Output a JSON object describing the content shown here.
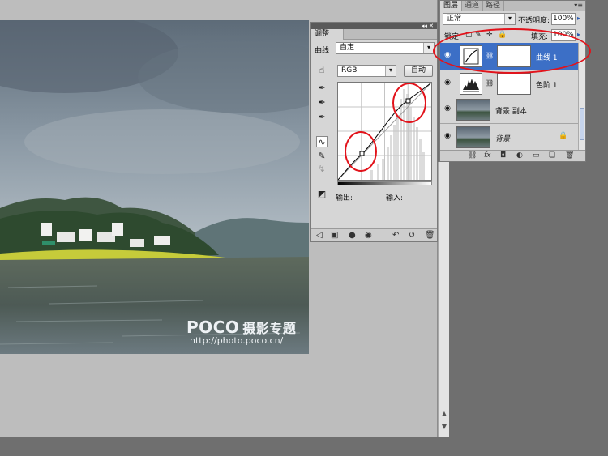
{
  "watermark": {
    "brand": "POCO",
    "brand_cn": "摄影专题",
    "url": "http://photo.poco.cn/"
  },
  "adjustments_panel": {
    "collapse_glyph": "◂◂",
    "close_glyph": "✕",
    "tab_label": "调整",
    "preset_label": "曲线",
    "preset_value": "自定",
    "channel_value": "RGB",
    "auto_button": "自动",
    "output_label": "输出:",
    "input_label": "输入:"
  },
  "layers_panel": {
    "tabs": [
      "图层",
      "通道",
      "路径"
    ],
    "menu_glyph": "▾≡",
    "blend_mode": "正常",
    "opacity_label": "不透明度:",
    "opacity_value": "100%",
    "lock_label": "锁定:",
    "fill_label": "填充:",
    "fill_value": "100%",
    "layers": [
      {
        "name": "曲线 1",
        "selected": true,
        "type": "curves-adjustment"
      },
      {
        "name": "色阶 1",
        "selected": false,
        "type": "levels-adjustment"
      },
      {
        "name": "背景 副本",
        "selected": false,
        "type": "image"
      },
      {
        "name": "背景",
        "selected": false,
        "type": "image",
        "locked": true
      }
    ]
  },
  "colors": {
    "selection_blue": "#3c6fc6",
    "annotation_red": "#e2131b",
    "panel_gray": "#d6d6d6"
  },
  "icons": [
    "eye-icon",
    "lock-icon",
    "link-icon",
    "fx-icon",
    "mask-icon",
    "adjustment-icon",
    "folder-icon",
    "new-layer-icon",
    "trash-icon",
    "dropdown-arrow-icon",
    "eyedropper-icon",
    "pencil-icon",
    "curve-tool-icon",
    "hand-tool-icon"
  ]
}
